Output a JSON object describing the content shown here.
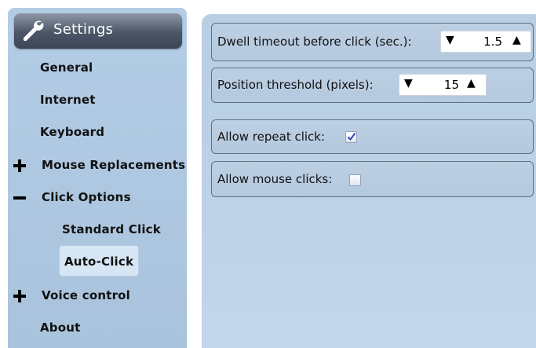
{
  "sidebar": {
    "header": {
      "title": "Settings",
      "icon": "wrench-icon"
    },
    "items": [
      {
        "label": "General"
      },
      {
        "label": "Internet"
      },
      {
        "label": "Keyboard"
      },
      {
        "label": "Mouse Replacements",
        "expander": "plus"
      },
      {
        "label": "Click Options",
        "expander": "minus"
      },
      {
        "label": "Standard Click"
      },
      {
        "label": "Auto-Click",
        "selected": true
      },
      {
        "label": "Voice control",
        "expander": "plus"
      },
      {
        "label": "About"
      }
    ]
  },
  "main": {
    "dwell": {
      "label": "Dwell timeout before click (sec.):",
      "value": "1.5",
      "down": "▼",
      "up": "▲"
    },
    "threshold": {
      "label": "Position threshold (pixels):",
      "value": "15",
      "down": "▼",
      "up": "▲"
    },
    "repeat": {
      "label": "Allow repeat click:",
      "checked": true
    },
    "mouse": {
      "label": "Allow mouse clicks:",
      "checked": false
    }
  },
  "colors": {
    "sidebar_bg": "#b4cde6",
    "header_bg": "#4a5566",
    "selected_bg": "#d7e6f4",
    "main_bg": "#bdd2e7",
    "check_color": "#3b3fb5"
  }
}
